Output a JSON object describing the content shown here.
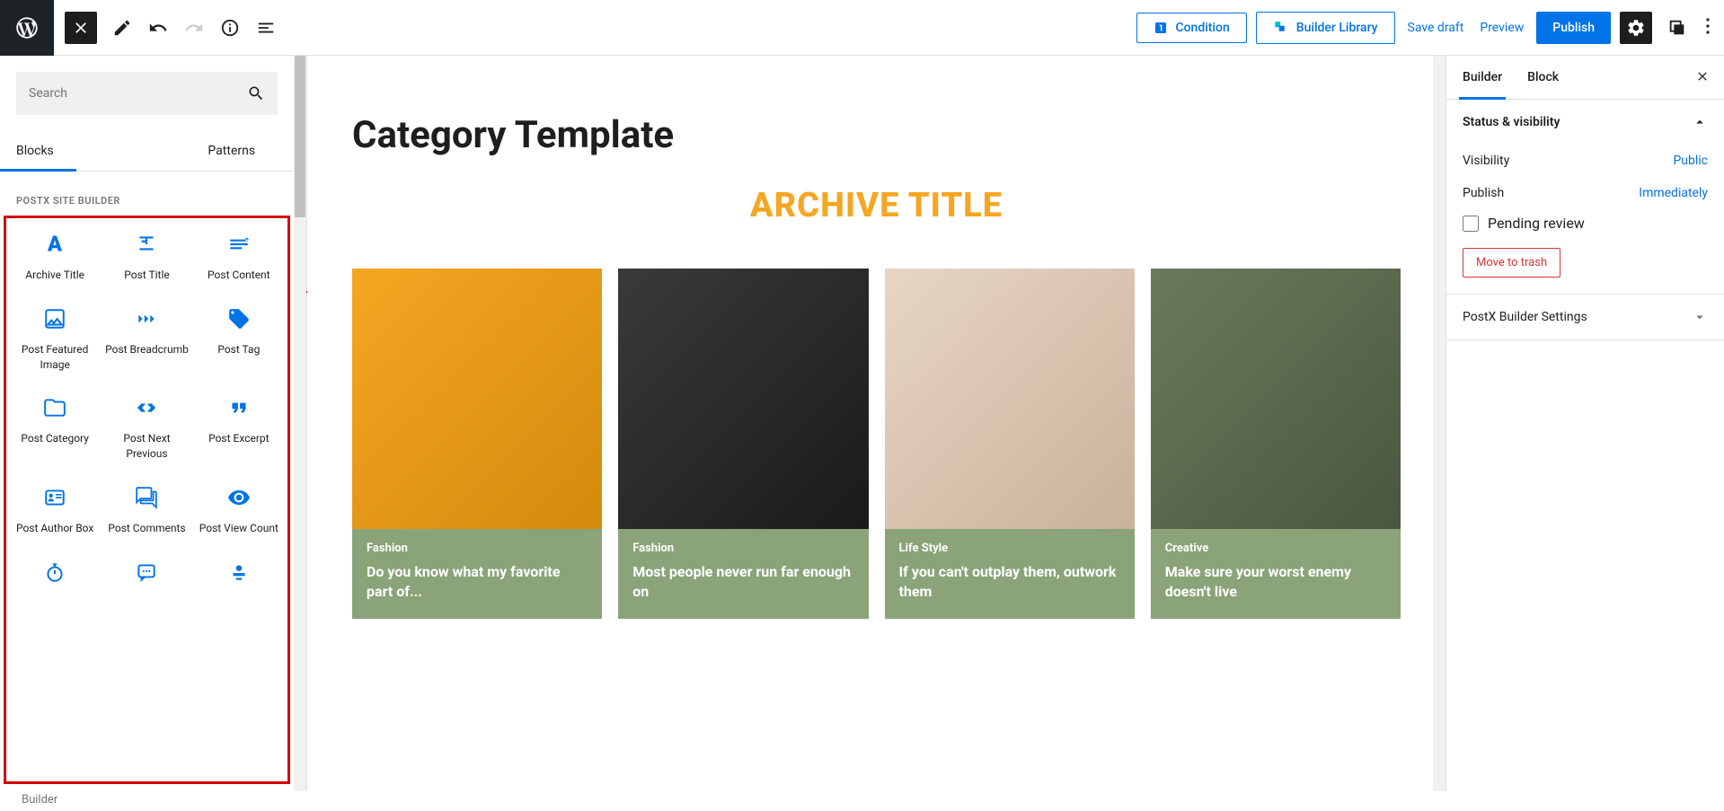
{
  "header": {
    "condition": "Condition",
    "library": "Builder Library",
    "save_draft": "Save draft",
    "preview": "Preview",
    "publish": "Publish"
  },
  "left": {
    "search_placeholder": "Search",
    "tab_blocks": "Blocks",
    "tab_patterns": "Patterns",
    "section_title": "POSTX SITE BUILDER",
    "blocks": [
      {
        "label": "Archive Title"
      },
      {
        "label": "Post Title"
      },
      {
        "label": "Post Content"
      },
      {
        "label": "Post Featured Image"
      },
      {
        "label": "Post Breadcrumb"
      },
      {
        "label": "Post Tag"
      },
      {
        "label": "Post Category"
      },
      {
        "label": "Post Next Previous"
      },
      {
        "label": "Post Excerpt"
      },
      {
        "label": "Post Author Box"
      },
      {
        "label": "Post Comments"
      },
      {
        "label": "Post View Count"
      }
    ]
  },
  "canvas": {
    "page_title": "Category Template",
    "archive_title": "ARCHIVE TITLE",
    "posts": [
      {
        "category": "Fashion",
        "title": "Do you know what my favorite part of..."
      },
      {
        "category": "Fashion",
        "title": "Most people never run far enough on"
      },
      {
        "category": "Life Style",
        "title": "If you can't outplay them, outwork them"
      },
      {
        "category": "Creative",
        "title": "Make sure your worst enemy doesn't live"
      }
    ]
  },
  "right": {
    "tab_builder": "Builder",
    "tab_block": "Block",
    "status_visibility": "Status & visibility",
    "visibility_label": "Visibility",
    "visibility_value": "Public",
    "publish_label": "Publish",
    "publish_value": "Immediately",
    "pending_review": "Pending review",
    "trash": "Move to trash",
    "postx_settings": "PostX Builder Settings"
  },
  "status": "Builder"
}
